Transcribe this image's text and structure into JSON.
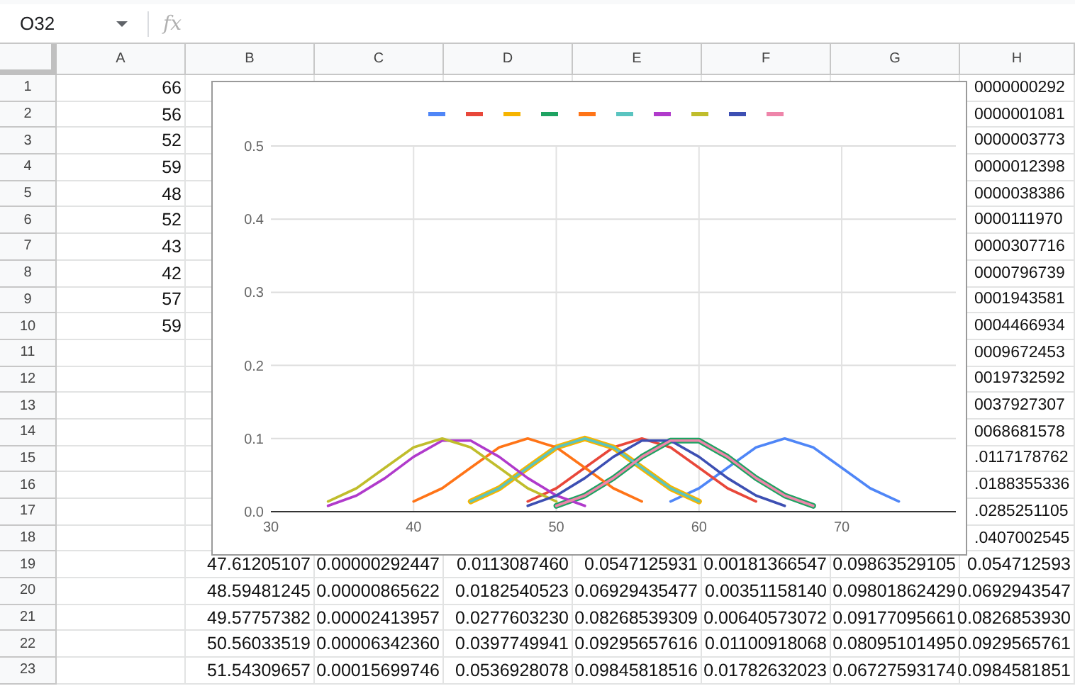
{
  "name_box": {
    "value": "O32"
  },
  "formula_label": "fx",
  "columns": [
    "A",
    "B",
    "C",
    "D",
    "E",
    "F",
    "G",
    "H"
  ],
  "rows": [
    {
      "number": "1",
      "a": "66",
      "h": "0000000292"
    },
    {
      "number": "2",
      "a": "56",
      "h": "0000001081"
    },
    {
      "number": "3",
      "a": "52",
      "h": "0000003773"
    },
    {
      "number": "4",
      "a": "59",
      "h": "0000012398"
    },
    {
      "number": "5",
      "a": "48",
      "h": "0000038386"
    },
    {
      "number": "6",
      "a": "52",
      "h": "0000111970"
    },
    {
      "number": "7",
      "a": "43",
      "h": "0000307716"
    },
    {
      "number": "8",
      "a": "42",
      "h": "0000796739"
    },
    {
      "number": "9",
      "a": "57",
      "h": "0001943581"
    },
    {
      "number": "10",
      "a": "59",
      "h": "0004466934"
    },
    {
      "number": "11",
      "h": "0009672453"
    },
    {
      "number": "12",
      "h": "0019732592"
    },
    {
      "number": "13",
      "h": "0037927307"
    },
    {
      "number": "14",
      "h": "0068681578"
    },
    {
      "number": "15",
      "h": ".0117178762"
    },
    {
      "number": "16",
      "h": ".0188355336"
    },
    {
      "number": "17",
      "h": ".0285251105"
    },
    {
      "number": "18",
      "h": ".0407002545"
    },
    {
      "number": "19",
      "values": [
        "47.61205107",
        "0.00000292447",
        "0.0113087460",
        "0.0547125931",
        "0.00181366547",
        "0.09863529105",
        "0.054712593"
      ]
    },
    {
      "number": "20",
      "values": [
        "48.59481245",
        "0.00000865622",
        "0.0182540523",
        "0.06929435477",
        "0.00351158140",
        "0.09801862429",
        "0.0692943547"
      ]
    },
    {
      "number": "21",
      "values": [
        "49.57757382",
        "0.00002413957",
        "0.0277603230",
        "0.08268539309",
        "0.00640573072",
        "0.09177095661",
        "0.0826853930"
      ]
    },
    {
      "number": "22",
      "values": [
        "50.56033519",
        "0.00006342360",
        "0.0397749941",
        "0.09295657616",
        "0.01100918068",
        "0.08095101495",
        "0.0929565761"
      ]
    },
    {
      "number": "23",
      "values": [
        "51.54309657",
        "0.00015699746",
        "0.0536928078",
        "0.09845818516",
        "0.01782632023",
        "0.06727593174",
        "0.0984581851"
      ]
    }
  ],
  "chart": {
    "chart_data": {
      "type": "line",
      "grid": true,
      "x": [
        34,
        36,
        38,
        40,
        42,
        44,
        46,
        48,
        50,
        52,
        54,
        56,
        58,
        60,
        62,
        64,
        66,
        68,
        70,
        72,
        74
      ],
      "xlim": [
        30,
        78
      ],
      "ylim": [
        0,
        0.5
      ],
      "xticks": [
        30,
        40,
        50,
        60,
        70
      ],
      "yticks": [
        {
          "value": 0,
          "label": "0.0"
        },
        {
          "value": 0.1,
          "label": "0.1"
        },
        {
          "value": 0.2,
          "label": "0.2"
        },
        {
          "value": 0.3,
          "label": "0.3"
        },
        {
          "value": 0.4,
          "label": "0.4"
        },
        {
          "value": 0.5,
          "label": "0.5"
        }
      ],
      "series": [
        {
          "color": "#4f86f7",
          "values": [
            null,
            null,
            null,
            null,
            null,
            null,
            null,
            null,
            null,
            null,
            null,
            null,
            0.014,
            0.032,
            0.06,
            0.088,
            0.1,
            0.088,
            0.06,
            0.032,
            0.014
          ]
        },
        {
          "color": "#e8473a",
          "values": [
            null,
            null,
            null,
            null,
            null,
            null,
            null,
            0.014,
            0.032,
            0.06,
            0.088,
            0.1,
            0.088,
            0.06,
            0.032,
            0.014,
            null,
            null,
            null,
            null,
            null
          ]
        },
        {
          "color": "#f6b400",
          "values": [
            null,
            null,
            null,
            null,
            null,
            0.014,
            0.032,
            0.06,
            0.088,
            0.1,
            0.088,
            0.06,
            0.032,
            0.014,
            null,
            null,
            null,
            null,
            null,
            null,
            null
          ]
        },
        {
          "color": "#1ea362",
          "values": [
            null,
            null,
            null,
            null,
            null,
            null,
            null,
            null,
            0.008,
            0.022,
            0.046,
            0.075,
            0.097,
            0.097,
            0.075,
            0.046,
            0.022,
            0.008,
            null,
            null,
            null
          ]
        },
        {
          "color": "#ff7417",
          "values": [
            null,
            null,
            null,
            0.014,
            0.032,
            0.06,
            0.088,
            0.1,
            0.088,
            0.06,
            0.032,
            0.014,
            null,
            null,
            null,
            null,
            null,
            null,
            null,
            null,
            null
          ]
        },
        {
          "color": "#5ac4c0",
          "values": [
            null,
            null,
            null,
            null,
            null,
            0.014,
            0.032,
            0.06,
            0.088,
            0.1,
            0.088,
            0.06,
            0.032,
            0.014,
            null,
            null,
            null,
            null,
            null,
            null,
            null
          ]
        },
        {
          "color": "#b03acb",
          "values": [
            0.008,
            0.022,
            0.046,
            0.075,
            0.097,
            0.097,
            0.075,
            0.046,
            0.022,
            0.008,
            null,
            null,
            null,
            null,
            null,
            null,
            null,
            null,
            null,
            null,
            null
          ]
        },
        {
          "color": "#c0bd2c",
          "values": [
            0.014,
            0.032,
            0.06,
            0.088,
            0.1,
            0.088,
            0.06,
            0.032,
            0.014,
            null,
            null,
            null,
            null,
            null,
            null,
            null,
            null,
            null,
            null,
            null,
            null
          ]
        },
        {
          "color": "#3d4fb3",
          "values": [
            null,
            null,
            null,
            null,
            null,
            null,
            null,
            0.008,
            0.022,
            0.046,
            0.075,
            0.097,
            0.097,
            0.075,
            0.046,
            0.022,
            0.008,
            null,
            null,
            null,
            null
          ]
        },
        {
          "color": "#ee85aa",
          "values": [
            null,
            null,
            null,
            null,
            null,
            null,
            null,
            null,
            0.008,
            0.022,
            0.046,
            0.075,
            0.097,
            0.097,
            0.075,
            0.046,
            0.022,
            0.008,
            null,
            null,
            null
          ]
        }
      ]
    }
  }
}
